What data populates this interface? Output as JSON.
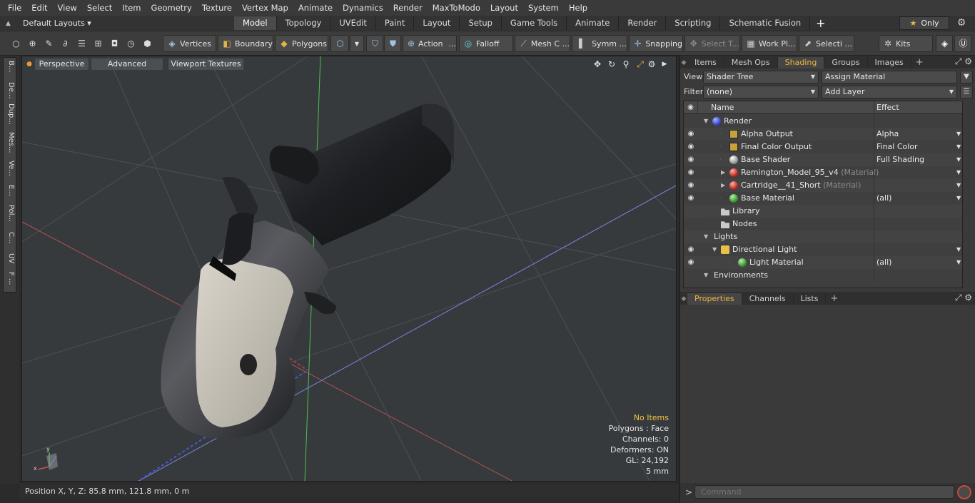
{
  "menu": [
    "File",
    "Edit",
    "View",
    "Select",
    "Item",
    "Geometry",
    "Texture",
    "Vertex Map",
    "Animate",
    "Dynamics",
    "Render",
    "MaxToModo",
    "Layout",
    "System",
    "Help"
  ],
  "layouts": {
    "selector": "Default Layouts ▾"
  },
  "tabs": [
    "Model",
    "Topology",
    "UVEdit",
    "Paint",
    "Layout",
    "Setup",
    "Game Tools",
    "Animate",
    "Render",
    "Scripting",
    "Schematic Fusion"
  ],
  "only_label": "Only",
  "toolbar": {
    "vertices": "Vertices",
    "boundary": "Boundary",
    "polygons": "Polygons",
    "action": "Action",
    "action_more": "...",
    "falloff": "Falloff",
    "mesh": "Mesh C ...",
    "symm": "Symm ...",
    "snapping": "Snapping",
    "select_t": "Select T...",
    "work_pl": "Work Pl...",
    "selecti": "Selecti ...",
    "kits": "Kits"
  },
  "left_tabs": [
    "B...",
    "De...",
    "Dup...",
    "Mes...",
    "Ve...",
    "E...",
    "Pol...",
    "C...",
    "UV",
    "F ..."
  ],
  "viewport": {
    "perspective": "Perspective",
    "advanced": "Advanced",
    "textures": "Viewport Textures",
    "info": {
      "no_items": "No Items",
      "polygons": "Polygons : Face",
      "channels": "Channels: 0",
      "deformers": "Deformers: ON",
      "gl": "GL: 24,192",
      "scale": "5 mm"
    }
  },
  "status": {
    "position": "Position X, Y, Z:   85.8 mm, 121.8 mm, 0 m"
  },
  "panel_top": {
    "tabs": [
      "Items",
      "Mesh Ops",
      "Shading",
      "Groups",
      "Images"
    ],
    "active": "Shading",
    "view_label": "View",
    "view_value": "Shader Tree",
    "assign_label": "Assign Material",
    "filter_label": "Filter",
    "filter_value": "(none)",
    "add_layer": "Add Layer",
    "col_name": "Name",
    "col_effect": "Effect"
  },
  "tree": [
    {
      "name": "Render",
      "sub": "",
      "effect": "",
      "icon": "sph-blue",
      "indent": 0,
      "eye": false,
      "exp": "▼"
    },
    {
      "name": "Alpha Output",
      "sub": "",
      "effect": "Alpha",
      "icon": "sq-out",
      "indent": 2,
      "eye": true,
      "exp": ""
    },
    {
      "name": "Final Color Output",
      "sub": "",
      "effect": "Final Color",
      "icon": "sq-out",
      "indent": 2,
      "eye": true,
      "exp": ""
    },
    {
      "name": "Base Shader",
      "sub": "",
      "effect": "Full Shading",
      "icon": "sph-grey",
      "indent": 2,
      "eye": true,
      "exp": ""
    },
    {
      "name": "Remington_Model_95_v4",
      "sub": " (Material)",
      "effect": "",
      "icon": "sph-red",
      "indent": 2,
      "eye": true,
      "exp": "▶"
    },
    {
      "name": "Cartridge__41_Short",
      "sub": " (Material)",
      "effect": "",
      "icon": "sph-red",
      "indent": 2,
      "eye": true,
      "exp": "▶"
    },
    {
      "name": "Base Material",
      "sub": "",
      "effect": "(all)",
      "icon": "sph-green",
      "indent": 2,
      "eye": true,
      "exp": ""
    },
    {
      "name": "Library",
      "sub": "",
      "effect": "",
      "icon": "folder",
      "indent": 1,
      "eye": false,
      "exp": ""
    },
    {
      "name": "Nodes",
      "sub": "",
      "effect": "",
      "icon": "folder",
      "indent": 1,
      "eye": false,
      "exp": ""
    },
    {
      "name": "Lights",
      "sub": "",
      "effect": "",
      "icon": "",
      "indent": 0,
      "eye": false,
      "exp": "▼"
    },
    {
      "name": "Directional Light",
      "sub": "",
      "effect": "",
      "icon": "light",
      "indent": 1,
      "eye": true,
      "exp": "▼"
    },
    {
      "name": "Light Material",
      "sub": "",
      "effect": "(all)",
      "icon": "sph-green",
      "indent": 3,
      "eye": true,
      "exp": ""
    },
    {
      "name": "Environments",
      "sub": "",
      "effect": "",
      "icon": "",
      "indent": 0,
      "eye": false,
      "exp": "▼"
    }
  ],
  "panel_bottom": {
    "tabs": [
      "Properties",
      "Channels",
      "Lists"
    ],
    "active": "Properties"
  },
  "command": {
    "placeholder": "Command"
  },
  "colors": {
    "accent": "#f0b43c",
    "viewport_bg": "#363a3d",
    "panel_bg": "#3a3a3a"
  }
}
